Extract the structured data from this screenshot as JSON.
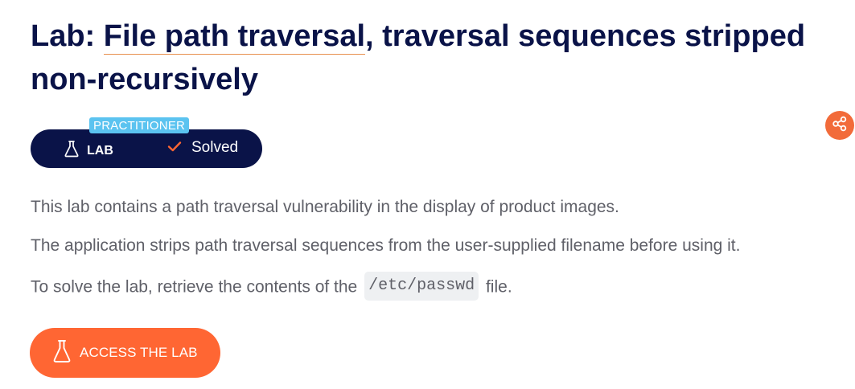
{
  "header": {
    "title_prefix": "Lab: ",
    "title_link": "File path traversal",
    "title_suffix": ", traversal sequences stripped non-recursively"
  },
  "badge": {
    "level": "PRACTITIONER",
    "type_label": "LAB",
    "status_label": "Solved"
  },
  "share": {
    "icon": "share-icon"
  },
  "description": {
    "line1": "This lab contains a path traversal vulnerability in the display of product images.",
    "line2": "The application strips path traversal sequences from the user-supplied filename before using it.",
    "line3_before": "To solve the lab, retrieve the contents of the",
    "line3_code": "/etc/passwd",
    "line3_after": "file."
  },
  "actions": {
    "access_label": "ACCESS THE LAB"
  },
  "colors": {
    "navy": "#0a1348",
    "orange": "#ff6633",
    "level_blue": "#5bc3f0",
    "body_text": "#5f6068"
  }
}
